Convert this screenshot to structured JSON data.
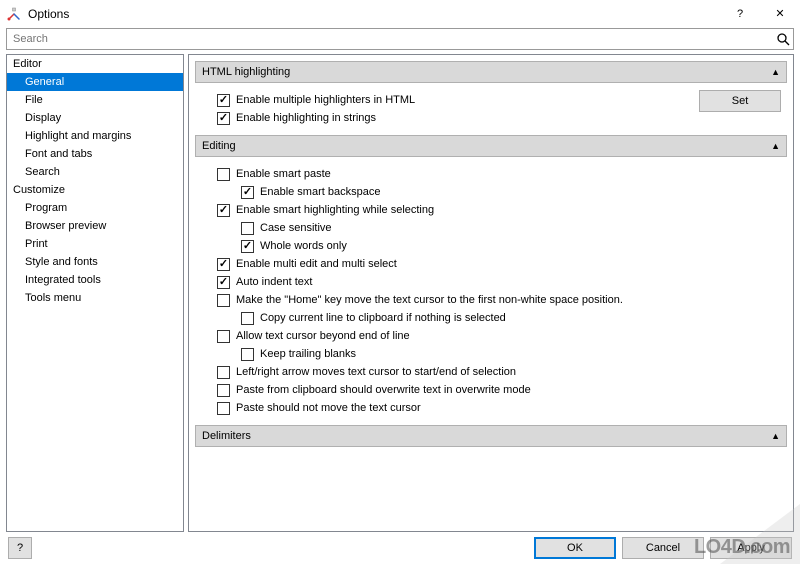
{
  "window": {
    "title": "Options",
    "help_glyph": "?",
    "close_glyph": "✕"
  },
  "search": {
    "placeholder": "Search"
  },
  "sidebar": {
    "categories": [
      {
        "label": "Editor",
        "items": [
          {
            "label": "General",
            "selected": true
          },
          {
            "label": "File",
            "selected": false
          },
          {
            "label": "Display",
            "selected": false
          },
          {
            "label": "Highlight and margins",
            "selected": false
          },
          {
            "label": "Font and tabs",
            "selected": false
          },
          {
            "label": "Search",
            "selected": false
          }
        ]
      },
      {
        "label": "Customize",
        "items": [
          {
            "label": "Program",
            "selected": false
          },
          {
            "label": "Browser preview",
            "selected": false
          },
          {
            "label": "Print",
            "selected": false
          },
          {
            "label": "Style and fonts",
            "selected": false
          },
          {
            "label": "Integrated tools",
            "selected": false
          },
          {
            "label": "Tools menu",
            "selected": false
          }
        ]
      }
    ]
  },
  "main": {
    "sections": [
      {
        "title": "HTML highlighting",
        "collapsed": false,
        "has_set_button": true,
        "set_label": "Set",
        "options": [
          {
            "label": "Enable multiple highlighters in HTML",
            "checked": true,
            "indent": 1
          },
          {
            "label": "Enable highlighting in strings",
            "checked": true,
            "indent": 1
          }
        ]
      },
      {
        "title": "Editing",
        "collapsed": false,
        "options": [
          {
            "label": "Enable smart paste",
            "checked": false,
            "indent": 1
          },
          {
            "label": "Enable smart backspace",
            "checked": true,
            "indent": 2
          },
          {
            "label": "Enable smart highlighting while selecting",
            "checked": true,
            "indent": 1
          },
          {
            "label": "Case sensitive",
            "checked": false,
            "indent": 2
          },
          {
            "label": "Whole words only",
            "checked": true,
            "indent": 2
          },
          {
            "label": "Enable multi edit and multi select",
            "checked": true,
            "indent": 1
          },
          {
            "label": "Auto indent text",
            "checked": true,
            "indent": 1
          },
          {
            "label": "Make the \"Home\" key move the text cursor to the first non-white space position.",
            "checked": false,
            "indent": 1
          },
          {
            "label": "Copy current line to clipboard if nothing is selected",
            "checked": false,
            "indent": 2
          },
          {
            "label": "Allow text cursor beyond end of line",
            "checked": false,
            "indent": 1
          },
          {
            "label": "Keep trailing blanks",
            "checked": false,
            "indent": 2
          },
          {
            "label": "Left/right arrow moves text cursor to start/end of selection",
            "checked": false,
            "indent": 1
          },
          {
            "label": "Paste from clipboard should overwrite text in overwrite mode",
            "checked": false,
            "indent": 1
          },
          {
            "label": "Paste should not move the text cursor",
            "checked": false,
            "indent": 1
          }
        ]
      },
      {
        "title": "Delimiters",
        "collapsed": false,
        "options": []
      }
    ]
  },
  "footer": {
    "help": "?",
    "ok": "OK",
    "cancel": "Cancel",
    "apply": "Apply"
  },
  "watermark": {
    "text": "LO4D.com"
  }
}
